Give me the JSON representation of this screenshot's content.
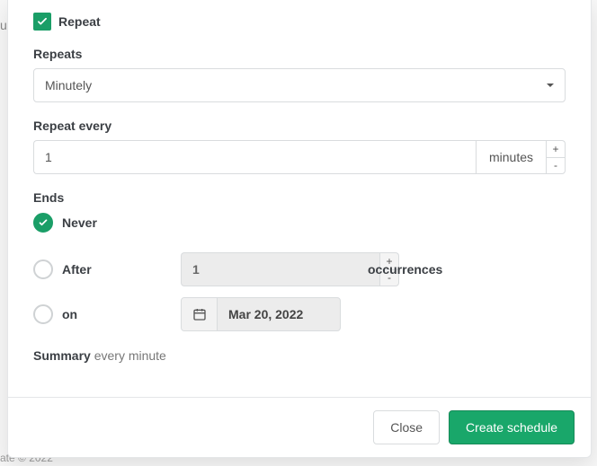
{
  "colors": {
    "accent": "#1a9e67",
    "primary_button": "#19a76a"
  },
  "background": {
    "left_hint": "u",
    "footer_text": "ate © 2022"
  },
  "repeat": {
    "checkbox_checked": true,
    "checkbox_label": "Repeat"
  },
  "repeats_section": {
    "label": "Repeats",
    "selected": "Minutely"
  },
  "repeat_every": {
    "label": "Repeat every",
    "value": "1",
    "unit": "minutes",
    "inc": "+",
    "dec": "-"
  },
  "ends": {
    "label": "Ends",
    "options": {
      "never": {
        "label": "Never",
        "selected": true
      },
      "after": {
        "label": "After",
        "selected": false,
        "value": "1",
        "suffix": "occurrences",
        "inc": "+",
        "dec": "-"
      },
      "on": {
        "label": "on",
        "selected": false,
        "date": "Mar 20, 2022"
      }
    }
  },
  "summary": {
    "label": "Summary",
    "text": "every minute"
  },
  "footer": {
    "close": "Close",
    "create": "Create schedule"
  }
}
